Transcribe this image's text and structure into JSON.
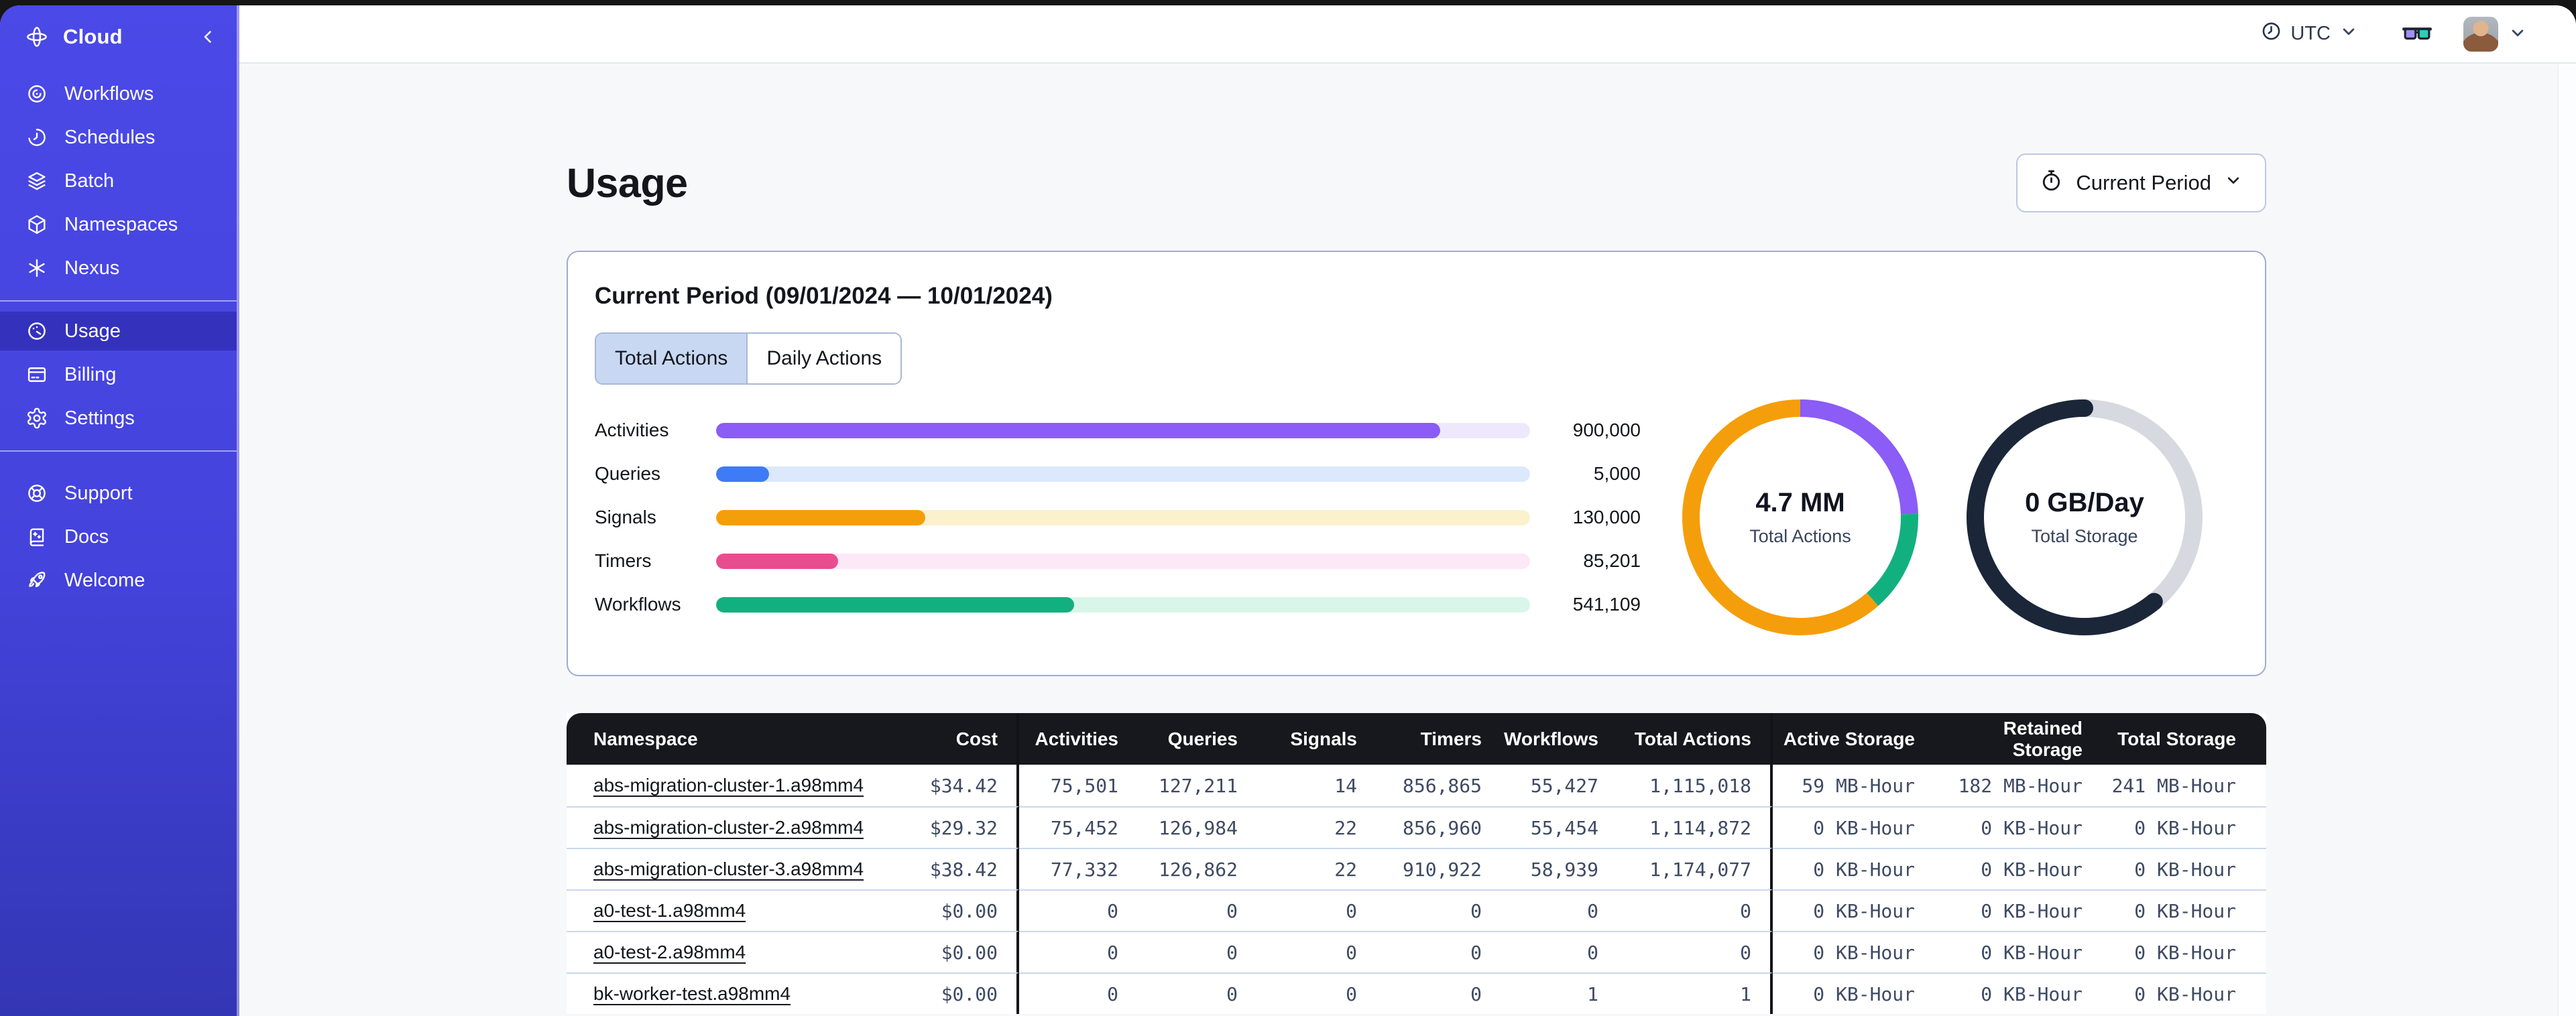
{
  "topbar": {
    "timezone_label": "UTC"
  },
  "sidebar": {
    "brand": "Cloud",
    "nav_main": [
      {
        "label": "Workflows",
        "icon": "workflows"
      },
      {
        "label": "Schedules",
        "icon": "schedules"
      },
      {
        "label": "Batch",
        "icon": "batch"
      },
      {
        "label": "Namespaces",
        "icon": "namespaces"
      },
      {
        "label": "Nexus",
        "icon": "nexus"
      }
    ],
    "nav_account": [
      {
        "label": "Usage",
        "icon": "usage",
        "selected": true
      },
      {
        "label": "Billing",
        "icon": "billing"
      },
      {
        "label": "Settings",
        "icon": "settings"
      }
    ],
    "nav_help": [
      {
        "label": "Support",
        "icon": "support"
      },
      {
        "label": "Docs",
        "icon": "docs"
      },
      {
        "label": "Welcome",
        "icon": "welcome"
      }
    ]
  },
  "page": {
    "title": "Usage",
    "period_button_label": "Current Period"
  },
  "usage_card": {
    "title": "Current Period (09/01/2024 — 10/01/2024)",
    "tabs": [
      {
        "label": "Total Actions",
        "selected": true
      },
      {
        "label": "Daily Actions",
        "selected": false
      }
    ]
  },
  "chart_data": {
    "bar_chart": {
      "type": "bar",
      "orientation": "horizontal",
      "categories": [
        "Activities",
        "Queries",
        "Signals",
        "Timers",
        "Workflows"
      ],
      "values": [
        900000,
        5000,
        130000,
        85201,
        541109
      ],
      "bars": [
        {
          "label": "Activities",
          "value": 900000,
          "value_label": "900,000",
          "color": "#8B5CF6",
          "track_color": "#EDE8FC",
          "fill_pct": "89%"
        },
        {
          "label": "Queries",
          "value": 5000,
          "value_label": "5,000",
          "color": "#3F7BF4",
          "track_color": "#DCE9FC",
          "fill_pct": "6.5%"
        },
        {
          "label": "Signals",
          "value": 130000,
          "value_label": "130,000",
          "color": "#F59E0B",
          "track_color": "#FCF1CD",
          "fill_pct": "25.7%"
        },
        {
          "label": "Timers",
          "value": 85201,
          "value_label": "85,201",
          "color": "#E84D90",
          "track_color": "#FDE8F7",
          "fill_pct": "15%"
        },
        {
          "label": "Workflows",
          "value": 541109,
          "value_label": "541,109",
          "color": "#13B07F",
          "track_color": "#D9F6EA",
          "fill_pct": "44%"
        }
      ]
    },
    "donuts": [
      {
        "type": "donut",
        "title": "4.7 MM",
        "subtitle": "Total Actions",
        "segments": [
          {
            "name": "activities-share",
            "color": "#8B5CF6",
            "fraction": 0.245
          },
          {
            "name": "workflows-share",
            "color": "#13B07F",
            "fraction": 0.14
          },
          {
            "name": "other-share",
            "color": "#F59E0B",
            "fraction": 0.615
          }
        ]
      },
      {
        "type": "donut",
        "title": "0 GB/Day",
        "subtitle": "Total Storage",
        "segments": [
          {
            "name": "free-share",
            "color": "#D6D9DF",
            "fraction": 0.39
          },
          {
            "name": "used-share",
            "color": "#1B2639",
            "fraction": 0.61,
            "rounded": true
          }
        ]
      }
    ]
  },
  "table": {
    "columns": [
      "Namespace",
      "Cost",
      "Activities",
      "Queries",
      "Signals",
      "Timers",
      "Workflows",
      "Total Actions",
      "Active Storage",
      "Retained Storage",
      "Total Storage"
    ],
    "rows": [
      {
        "namespace": "abs-migration-cluster-1.a98mm4",
        "cost": "$34.42",
        "activities": "75,501",
        "queries": "127,211",
        "signals": "14",
        "timers": "856,865",
        "workflows": "55,427",
        "total_actions": "1,115,018",
        "active_storage": "59 MB-Hour",
        "retained_storage": "182 MB-Hour",
        "total_storage": "241 MB-Hour"
      },
      {
        "namespace": "abs-migration-cluster-2.a98mm4",
        "cost": "$29.32",
        "activities": "75,452",
        "queries": "126,984",
        "signals": "22",
        "timers": "856,960",
        "workflows": "55,454",
        "total_actions": "1,114,872",
        "active_storage": "0 KB-Hour",
        "retained_storage": "0 KB-Hour",
        "total_storage": "0 KB-Hour"
      },
      {
        "namespace": "abs-migration-cluster-3.a98mm4",
        "cost": "$38.42",
        "activities": "77,332",
        "queries": "126,862",
        "signals": "22",
        "timers": "910,922",
        "workflows": "58,939",
        "total_actions": "1,174,077",
        "active_storage": "0 KB-Hour",
        "retained_storage": "0 KB-Hour",
        "total_storage": "0 KB-Hour"
      },
      {
        "namespace": "a0-test-1.a98mm4",
        "cost": "$0.00",
        "activities": "0",
        "queries": "0",
        "signals": "0",
        "timers": "0",
        "workflows": "0",
        "total_actions": "0",
        "active_storage": "0 KB-Hour",
        "retained_storage": "0 KB-Hour",
        "total_storage": "0 KB-Hour"
      },
      {
        "namespace": "a0-test-2.a98mm4",
        "cost": "$0.00",
        "activities": "0",
        "queries": "0",
        "signals": "0",
        "timers": "0",
        "workflows": "0",
        "total_actions": "0",
        "active_storage": "0 KB-Hour",
        "retained_storage": "0 KB-Hour",
        "total_storage": "0 KB-Hour"
      },
      {
        "namespace": "bk-worker-test.a98mm4",
        "cost": "$0.00",
        "activities": "0",
        "queries": "0",
        "signals": "0",
        "timers": "0",
        "workflows": "1",
        "total_actions": "1",
        "active_storage": "0 KB-Hour",
        "retained_storage": "0 KB-Hour",
        "total_storage": "0 KB-Hour"
      }
    ]
  }
}
